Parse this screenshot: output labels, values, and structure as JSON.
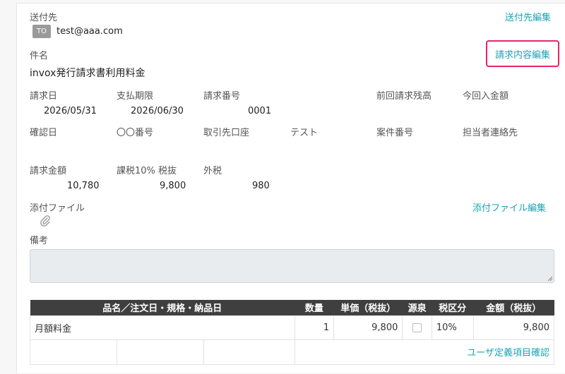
{
  "recipient": {
    "label": "送付先",
    "badge": "TO",
    "email": "test@aaa.com",
    "edit_link": "送付先編集"
  },
  "subject": {
    "label": "件名",
    "value": "invox発行請求書利用料金",
    "edit_link": "請求内容編集"
  },
  "row1": {
    "invoice_date_label": "請求日",
    "invoice_date": "2026/05/31",
    "due_date_label": "支払期限",
    "due_date": "2026/06/30",
    "invoice_no_label": "請求番号",
    "invoice_no": "0001",
    "prev_balance_label": "前回請求残高",
    "this_payment_label": "今回入金額"
  },
  "row2": {
    "confirm_date_label": "確認日",
    "oo_number_label": "〇〇番号",
    "account_label": "取引先口座",
    "test_label": "テスト",
    "case_no_label": "案件番号",
    "contact_label": "担当者連絡先"
  },
  "amounts": {
    "total_label": "請求金額",
    "total": "10,780",
    "taxable_label": "課税10% 税抜",
    "taxable": "9,800",
    "tax_label": "外税",
    "tax": "980"
  },
  "attachments": {
    "label": "添付ファイル",
    "edit_link": "添付ファイル編集"
  },
  "notes": {
    "label": "備考",
    "value": ""
  },
  "table": {
    "headers": [
      "品名／注文日・規格・納品日",
      "数量",
      "単価（税抜）",
      "源泉",
      "税区分",
      "金額（税抜）"
    ],
    "row": {
      "name": "月額料金",
      "qty": "1",
      "unit_price": "9,800",
      "tax_category": "10%",
      "amount": "9,800"
    },
    "user_defined_link": "ユーザ定義項目確認"
  },
  "colors": {
    "link": "#1aa3b5",
    "highlight": "#e8246a",
    "table_header": "#3f3f3f"
  }
}
